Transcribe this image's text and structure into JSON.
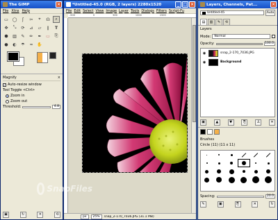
{
  "toolbox": {
    "title": "The GIMP",
    "menu": [
      "File",
      "Xtns",
      "Help"
    ],
    "tools": [
      "▭",
      "◯",
      "ʃ",
      "✂",
      "⌖",
      "☊",
      "⌕",
      "✥",
      "⤡",
      "⟳",
      "⊿",
      "▱",
      "∥",
      "T",
      "⬢",
      "▥",
      "✎",
      "✏",
      "✒",
      "▭",
      "⎘",
      "●",
      "◐",
      "☂",
      "≈",
      "✋"
    ],
    "tool_options": {
      "header": "Magnify",
      "auto_resize_label": "Auto-resize window",
      "auto_resize_checked": true,
      "tool_toggle_label": "Tool Toggle  <Ctrl>",
      "zoom_in_label": "Zoom in",
      "zoom_out_label": "Zoom out",
      "threshold_label": "Threshold:",
      "threshold_value": "4.8"
    }
  },
  "image_window": {
    "title": "*Untitled-45.0 (RGB, 2 layers) 2280x1520",
    "menu": [
      "File",
      "Edit",
      "Select",
      "View",
      "Image",
      "Layer",
      "Tools",
      "Dialogs",
      "Filters",
      "Script-Fu"
    ],
    "ruler_ticks": [
      "-500",
      "0",
      "500",
      "1000",
      "1500"
    ],
    "status": {
      "unit": "px",
      "zoom": "25%",
      "info": "snap_2-170_7036.JPG (31.1 MB)",
      "cancel_label": "Cancel"
    }
  },
  "layers_dock": {
    "title": "Layers, Channels, Pat...",
    "image_selector": "Untitled-45",
    "auto_label": "Auto",
    "layers_header": "Layers",
    "mode_label": "Mode:",
    "mode_value": "Normal",
    "opacity_label": "Opacity:",
    "opacity_value": "100.0",
    "layers": [
      {
        "name": "snap_2-170_7036.JPG",
        "visible": true
      },
      {
        "name": "Background",
        "visible": true
      }
    ],
    "brushes_header": "Brushes",
    "brush_name": "Circle (11) (11 x 11)",
    "spacing_label": "Spacing:",
    "spacing_value": "20.0"
  },
  "watermark": "SnapFiles",
  "colors": {
    "title_bar": "#1550c8",
    "window_bg": "#ece9d8",
    "desktop": "#6f8fb6",
    "petal": "#c2185b",
    "flower_center": "#c6d71f"
  }
}
